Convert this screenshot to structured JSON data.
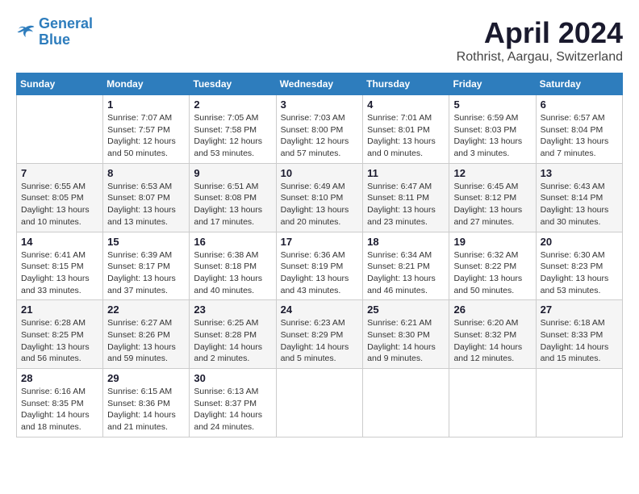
{
  "logo": {
    "line1": "General",
    "line2": "Blue"
  },
  "title": "April 2024",
  "location": "Rothrist, Aargau, Switzerland",
  "days_header": [
    "Sunday",
    "Monday",
    "Tuesday",
    "Wednesday",
    "Thursday",
    "Friday",
    "Saturday"
  ],
  "weeks": [
    [
      {
        "day": "",
        "sunrise": "",
        "sunset": "",
        "daylight": ""
      },
      {
        "day": "1",
        "sunrise": "Sunrise: 7:07 AM",
        "sunset": "Sunset: 7:57 PM",
        "daylight": "Daylight: 12 hours and 50 minutes."
      },
      {
        "day": "2",
        "sunrise": "Sunrise: 7:05 AM",
        "sunset": "Sunset: 7:58 PM",
        "daylight": "Daylight: 12 hours and 53 minutes."
      },
      {
        "day": "3",
        "sunrise": "Sunrise: 7:03 AM",
        "sunset": "Sunset: 8:00 PM",
        "daylight": "Daylight: 12 hours and 57 minutes."
      },
      {
        "day": "4",
        "sunrise": "Sunrise: 7:01 AM",
        "sunset": "Sunset: 8:01 PM",
        "daylight": "Daylight: 13 hours and 0 minutes."
      },
      {
        "day": "5",
        "sunrise": "Sunrise: 6:59 AM",
        "sunset": "Sunset: 8:03 PM",
        "daylight": "Daylight: 13 hours and 3 minutes."
      },
      {
        "day": "6",
        "sunrise": "Sunrise: 6:57 AM",
        "sunset": "Sunset: 8:04 PM",
        "daylight": "Daylight: 13 hours and 7 minutes."
      }
    ],
    [
      {
        "day": "7",
        "sunrise": "Sunrise: 6:55 AM",
        "sunset": "Sunset: 8:05 PM",
        "daylight": "Daylight: 13 hours and 10 minutes."
      },
      {
        "day": "8",
        "sunrise": "Sunrise: 6:53 AM",
        "sunset": "Sunset: 8:07 PM",
        "daylight": "Daylight: 13 hours and 13 minutes."
      },
      {
        "day": "9",
        "sunrise": "Sunrise: 6:51 AM",
        "sunset": "Sunset: 8:08 PM",
        "daylight": "Daylight: 13 hours and 17 minutes."
      },
      {
        "day": "10",
        "sunrise": "Sunrise: 6:49 AM",
        "sunset": "Sunset: 8:10 PM",
        "daylight": "Daylight: 13 hours and 20 minutes."
      },
      {
        "day": "11",
        "sunrise": "Sunrise: 6:47 AM",
        "sunset": "Sunset: 8:11 PM",
        "daylight": "Daylight: 13 hours and 23 minutes."
      },
      {
        "day": "12",
        "sunrise": "Sunrise: 6:45 AM",
        "sunset": "Sunset: 8:12 PM",
        "daylight": "Daylight: 13 hours and 27 minutes."
      },
      {
        "day": "13",
        "sunrise": "Sunrise: 6:43 AM",
        "sunset": "Sunset: 8:14 PM",
        "daylight": "Daylight: 13 hours and 30 minutes."
      }
    ],
    [
      {
        "day": "14",
        "sunrise": "Sunrise: 6:41 AM",
        "sunset": "Sunset: 8:15 PM",
        "daylight": "Daylight: 13 hours and 33 minutes."
      },
      {
        "day": "15",
        "sunrise": "Sunrise: 6:39 AM",
        "sunset": "Sunset: 8:17 PM",
        "daylight": "Daylight: 13 hours and 37 minutes."
      },
      {
        "day": "16",
        "sunrise": "Sunrise: 6:38 AM",
        "sunset": "Sunset: 8:18 PM",
        "daylight": "Daylight: 13 hours and 40 minutes."
      },
      {
        "day": "17",
        "sunrise": "Sunrise: 6:36 AM",
        "sunset": "Sunset: 8:19 PM",
        "daylight": "Daylight: 13 hours and 43 minutes."
      },
      {
        "day": "18",
        "sunrise": "Sunrise: 6:34 AM",
        "sunset": "Sunset: 8:21 PM",
        "daylight": "Daylight: 13 hours and 46 minutes."
      },
      {
        "day": "19",
        "sunrise": "Sunrise: 6:32 AM",
        "sunset": "Sunset: 8:22 PM",
        "daylight": "Daylight: 13 hours and 50 minutes."
      },
      {
        "day": "20",
        "sunrise": "Sunrise: 6:30 AM",
        "sunset": "Sunset: 8:23 PM",
        "daylight": "Daylight: 13 hours and 53 minutes."
      }
    ],
    [
      {
        "day": "21",
        "sunrise": "Sunrise: 6:28 AM",
        "sunset": "Sunset: 8:25 PM",
        "daylight": "Daylight: 13 hours and 56 minutes."
      },
      {
        "day": "22",
        "sunrise": "Sunrise: 6:27 AM",
        "sunset": "Sunset: 8:26 PM",
        "daylight": "Daylight: 13 hours and 59 minutes."
      },
      {
        "day": "23",
        "sunrise": "Sunrise: 6:25 AM",
        "sunset": "Sunset: 8:28 PM",
        "daylight": "Daylight: 14 hours and 2 minutes."
      },
      {
        "day": "24",
        "sunrise": "Sunrise: 6:23 AM",
        "sunset": "Sunset: 8:29 PM",
        "daylight": "Daylight: 14 hours and 5 minutes."
      },
      {
        "day": "25",
        "sunrise": "Sunrise: 6:21 AM",
        "sunset": "Sunset: 8:30 PM",
        "daylight": "Daylight: 14 hours and 9 minutes."
      },
      {
        "day": "26",
        "sunrise": "Sunrise: 6:20 AM",
        "sunset": "Sunset: 8:32 PM",
        "daylight": "Daylight: 14 hours and 12 minutes."
      },
      {
        "day": "27",
        "sunrise": "Sunrise: 6:18 AM",
        "sunset": "Sunset: 8:33 PM",
        "daylight": "Daylight: 14 hours and 15 minutes."
      }
    ],
    [
      {
        "day": "28",
        "sunrise": "Sunrise: 6:16 AM",
        "sunset": "Sunset: 8:35 PM",
        "daylight": "Daylight: 14 hours and 18 minutes."
      },
      {
        "day": "29",
        "sunrise": "Sunrise: 6:15 AM",
        "sunset": "Sunset: 8:36 PM",
        "daylight": "Daylight: 14 hours and 21 minutes."
      },
      {
        "day": "30",
        "sunrise": "Sunrise: 6:13 AM",
        "sunset": "Sunset: 8:37 PM",
        "daylight": "Daylight: 14 hours and 24 minutes."
      },
      {
        "day": "",
        "sunrise": "",
        "sunset": "",
        "daylight": ""
      },
      {
        "day": "",
        "sunrise": "",
        "sunset": "",
        "daylight": ""
      },
      {
        "day": "",
        "sunrise": "",
        "sunset": "",
        "daylight": ""
      },
      {
        "day": "",
        "sunrise": "",
        "sunset": "",
        "daylight": ""
      }
    ]
  ]
}
